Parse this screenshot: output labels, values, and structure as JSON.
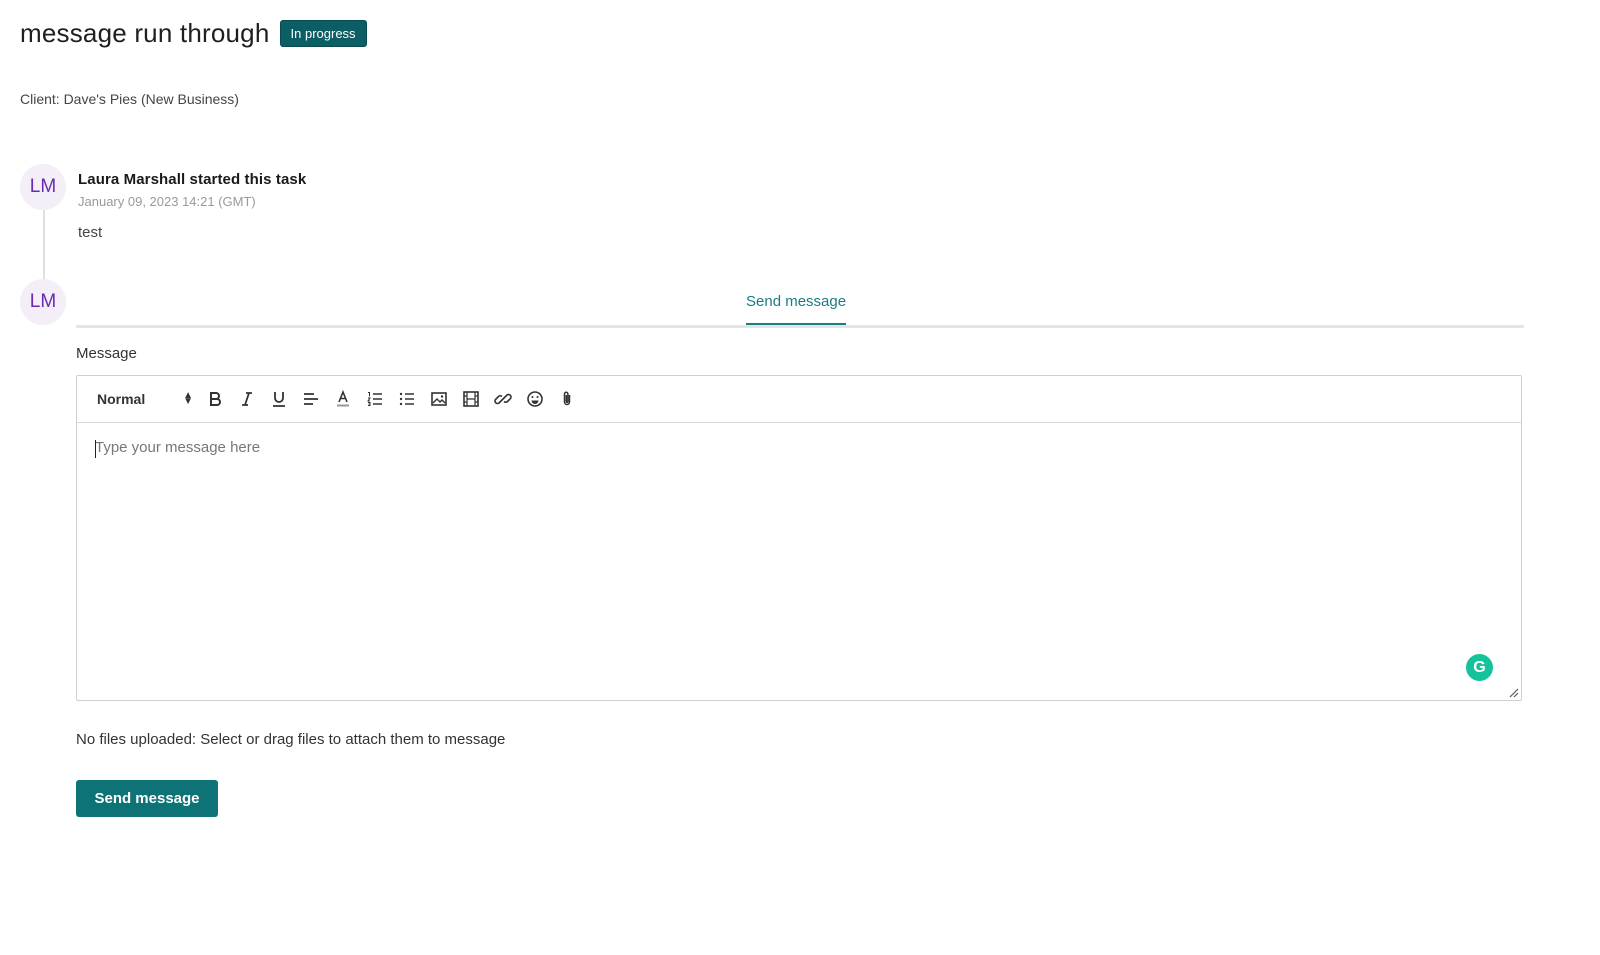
{
  "task": {
    "title": "message run through",
    "status": "In progress",
    "client_line": "Client: Dave's Pies (New Business)"
  },
  "timeline": {
    "avatar_initials": "LM",
    "event_title": "Laura Marshall started this task",
    "event_time": "January 09, 2023 14:21 (GMT)",
    "event_body": "test"
  },
  "composer": {
    "avatar_initials": "LM",
    "tab_label": "Send message",
    "message_label": "Message",
    "format_value": "Normal",
    "placeholder": "Type your message here",
    "toolbar_icons": [
      "bold-icon",
      "italic-icon",
      "underline-icon",
      "align-icon",
      "text-color-icon",
      "ordered-list-icon",
      "bullet-list-icon",
      "image-icon",
      "video-icon",
      "link-icon",
      "emoji-icon",
      "attachment-icon"
    ],
    "grammarly_letter": "G",
    "files_note": "No files uploaded: Select or drag files to attach them to message",
    "send_label": "Send message"
  },
  "colors": {
    "accent": "#0e7377",
    "badge": "#0b5e63",
    "avatar_text": "#6a2bb0",
    "grammarly": "#15c39a"
  }
}
